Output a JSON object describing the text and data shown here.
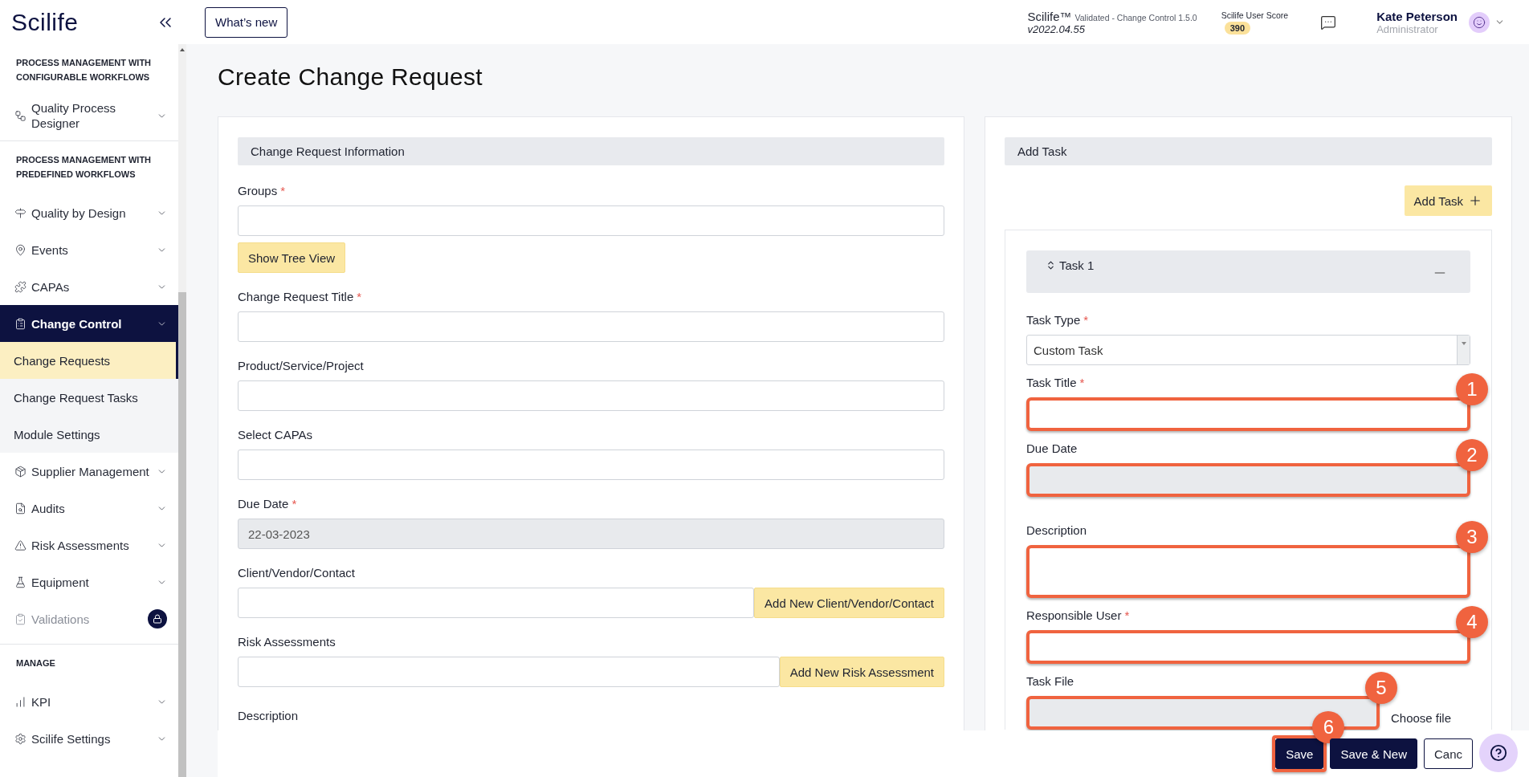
{
  "sidebar": {
    "logo": "Scilife",
    "sections": [
      {
        "heading": "PROCESS MANAGEMENT WITH CONFIGURABLE WORKFLOWS",
        "items": [
          {
            "label": "Quality Process Designer",
            "selected": false,
            "locked": false
          }
        ]
      },
      {
        "heading": "PROCESS MANAGEMENT WITH PREDEFINED WORKFLOWS",
        "items": [
          {
            "label": "Quality by Design",
            "selected": false,
            "locked": false
          },
          {
            "label": "Events",
            "selected": false,
            "locked": false
          },
          {
            "label": "CAPAs",
            "selected": false,
            "locked": false
          },
          {
            "label": "Change Control",
            "selected": true,
            "locked": false,
            "children": [
              {
                "label": "Change Requests",
                "selected": true
              },
              {
                "label": "Change Request Tasks",
                "selected": false
              },
              {
                "label": "Module Settings",
                "selected": false
              }
            ]
          },
          {
            "label": "Supplier Management",
            "selected": false,
            "locked": false
          },
          {
            "label": "Audits",
            "selected": false,
            "locked": false
          },
          {
            "label": "Risk Assessments",
            "selected": false,
            "locked": false
          },
          {
            "label": "Equipment",
            "selected": false,
            "locked": false
          },
          {
            "label": "Validations",
            "selected": false,
            "locked": true
          }
        ]
      },
      {
        "heading": "MANAGE",
        "items": [
          {
            "label": "KPI",
            "selected": false,
            "locked": false
          },
          {
            "label": "Scilife Settings",
            "selected": false,
            "locked": false
          }
        ]
      }
    ]
  },
  "topbar": {
    "whats_new": "What’s new",
    "product": "Scilife™",
    "edition": "Validated - Change Control 1.5.0",
    "version": "v2022.04.55",
    "score_label": "Scilife User Score",
    "score": "390",
    "user_name": "Kate Peterson",
    "user_role": "Administrator"
  },
  "page_title": "Create Change Request",
  "change_request": {
    "heading": "Change Request Information",
    "fields": [
      {
        "label": "Groups",
        "kind": "tree",
        "required_mark": "*",
        "button": "Show Tree View"
      },
      {
        "label": "Change Request Title",
        "kind": "text",
        "required_mark": "*"
      },
      {
        "label": "Product/Service/Project",
        "kind": "text"
      },
      {
        "label": "Select CAPAs",
        "kind": "text"
      },
      {
        "label": "Due Date",
        "kind": "date",
        "required_mark": "*",
        "value": "22-03-2023"
      },
      {
        "label": "Client/Vendor/Contact",
        "kind": "addon",
        "button": "Add New Client/Vendor/Contact"
      },
      {
        "label": "Risk Assessments",
        "kind": "addon",
        "button": "Add New Risk Assessment"
      },
      {
        "label": "Description",
        "kind": "label"
      }
    ]
  },
  "add_task": {
    "heading": "Add Task",
    "add_button": "Add Task",
    "task": {
      "title": "Task 1",
      "fields": [
        {
          "label": "Task Type",
          "kind": "select",
          "required_mark": "*",
          "value": "Custom Task"
        },
        {
          "label": "Task Title",
          "kind": "text",
          "required_mark": "*",
          "annotation": "1"
        },
        {
          "label": "Due Date",
          "kind": "date",
          "annotation": "2"
        },
        {
          "label": "Description",
          "kind": "textarea",
          "annotation": "3"
        },
        {
          "label": "Responsible User",
          "kind": "text",
          "required_mark": "*",
          "annotation": "4"
        },
        {
          "label": "Task File",
          "kind": "file",
          "annotation": "5",
          "button": "Choose file"
        }
      ]
    }
  },
  "footer": {
    "buttons": [
      {
        "label": "Save",
        "kind": "primary",
        "annotation": "6"
      },
      {
        "label": "Save & New",
        "kind": "primary"
      },
      {
        "label": "Canc",
        "kind": "outline"
      }
    ]
  }
}
